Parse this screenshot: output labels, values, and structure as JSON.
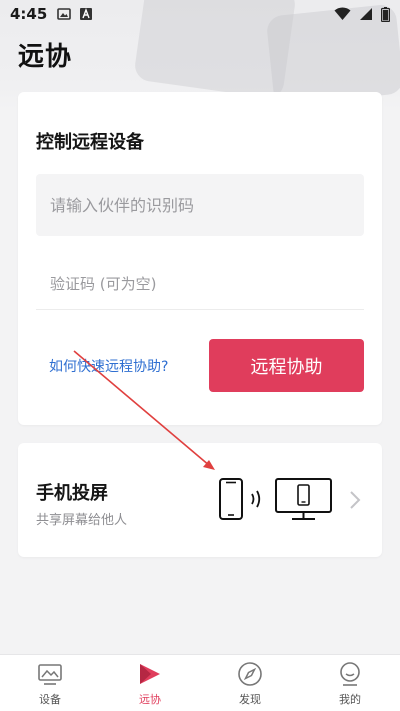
{
  "status_bar": {
    "time": "4:45",
    "icons": [
      "image-icon",
      "a-icon",
      "wifi-icon",
      "signal-icon",
      "battery-icon"
    ]
  },
  "page": {
    "title": "远协"
  },
  "remote_card": {
    "heading": "控制远程设备",
    "partner_placeholder": "请输入伙伴的识别码",
    "code_placeholder": "验证码 (可为空)",
    "help_link": "如何快速远程协助?",
    "assist_button": "远程协助"
  },
  "cast_card": {
    "title": "手机投屏",
    "subtitle": "共享屏幕给他人"
  },
  "bottom_nav": {
    "items": [
      {
        "label": "设备",
        "icon": "device-icon",
        "active": false
      },
      {
        "label": "远协",
        "icon": "remote-assist-icon",
        "active": true
      },
      {
        "label": "发现",
        "icon": "compass-icon",
        "active": false
      },
      {
        "label": "我的",
        "icon": "profile-icon",
        "active": false
      }
    ]
  },
  "colors": {
    "accent": "#e03d5c",
    "link": "#2f6fd1",
    "annotation_arrow": "#e0403f",
    "background": "#f3f3f4"
  }
}
